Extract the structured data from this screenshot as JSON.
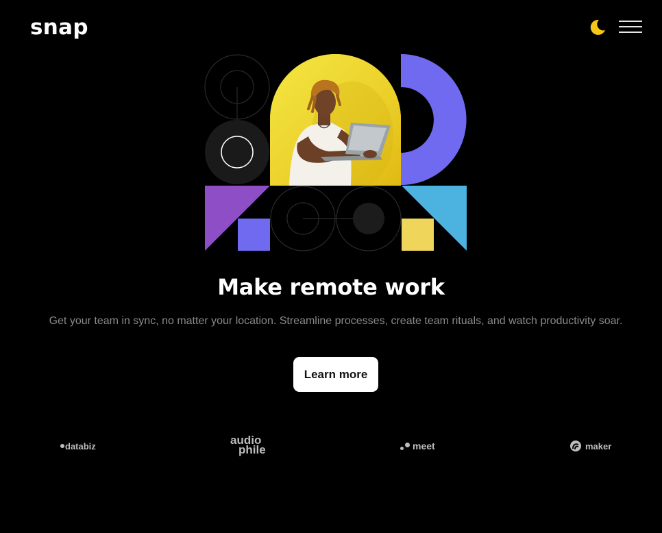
{
  "header": {
    "logo_text": "snap",
    "theme_toggle_icon": "moon-icon",
    "menu_icon": "hamburger-menu-icon"
  },
  "hero": {
    "headline": "Make remote work",
    "subtext": "Get your team in sync, no matter your location. Streamline processes, create team rituals, and watch productivity soar.",
    "cta_label": "Learn more"
  },
  "clients": [
    {
      "name": "databiz"
    },
    {
      "name": "audiophile",
      "line1": "audio",
      "line2": "phile"
    },
    {
      "name": "meet"
    },
    {
      "name": "maker"
    }
  ],
  "colors": {
    "background": "#000000",
    "accent_yellow": "#F5C518",
    "purple": "#7E5BD6",
    "violet": "#6F6AF0",
    "cyan": "#4CB2E0",
    "soft_yellow": "#EFD55A"
  }
}
